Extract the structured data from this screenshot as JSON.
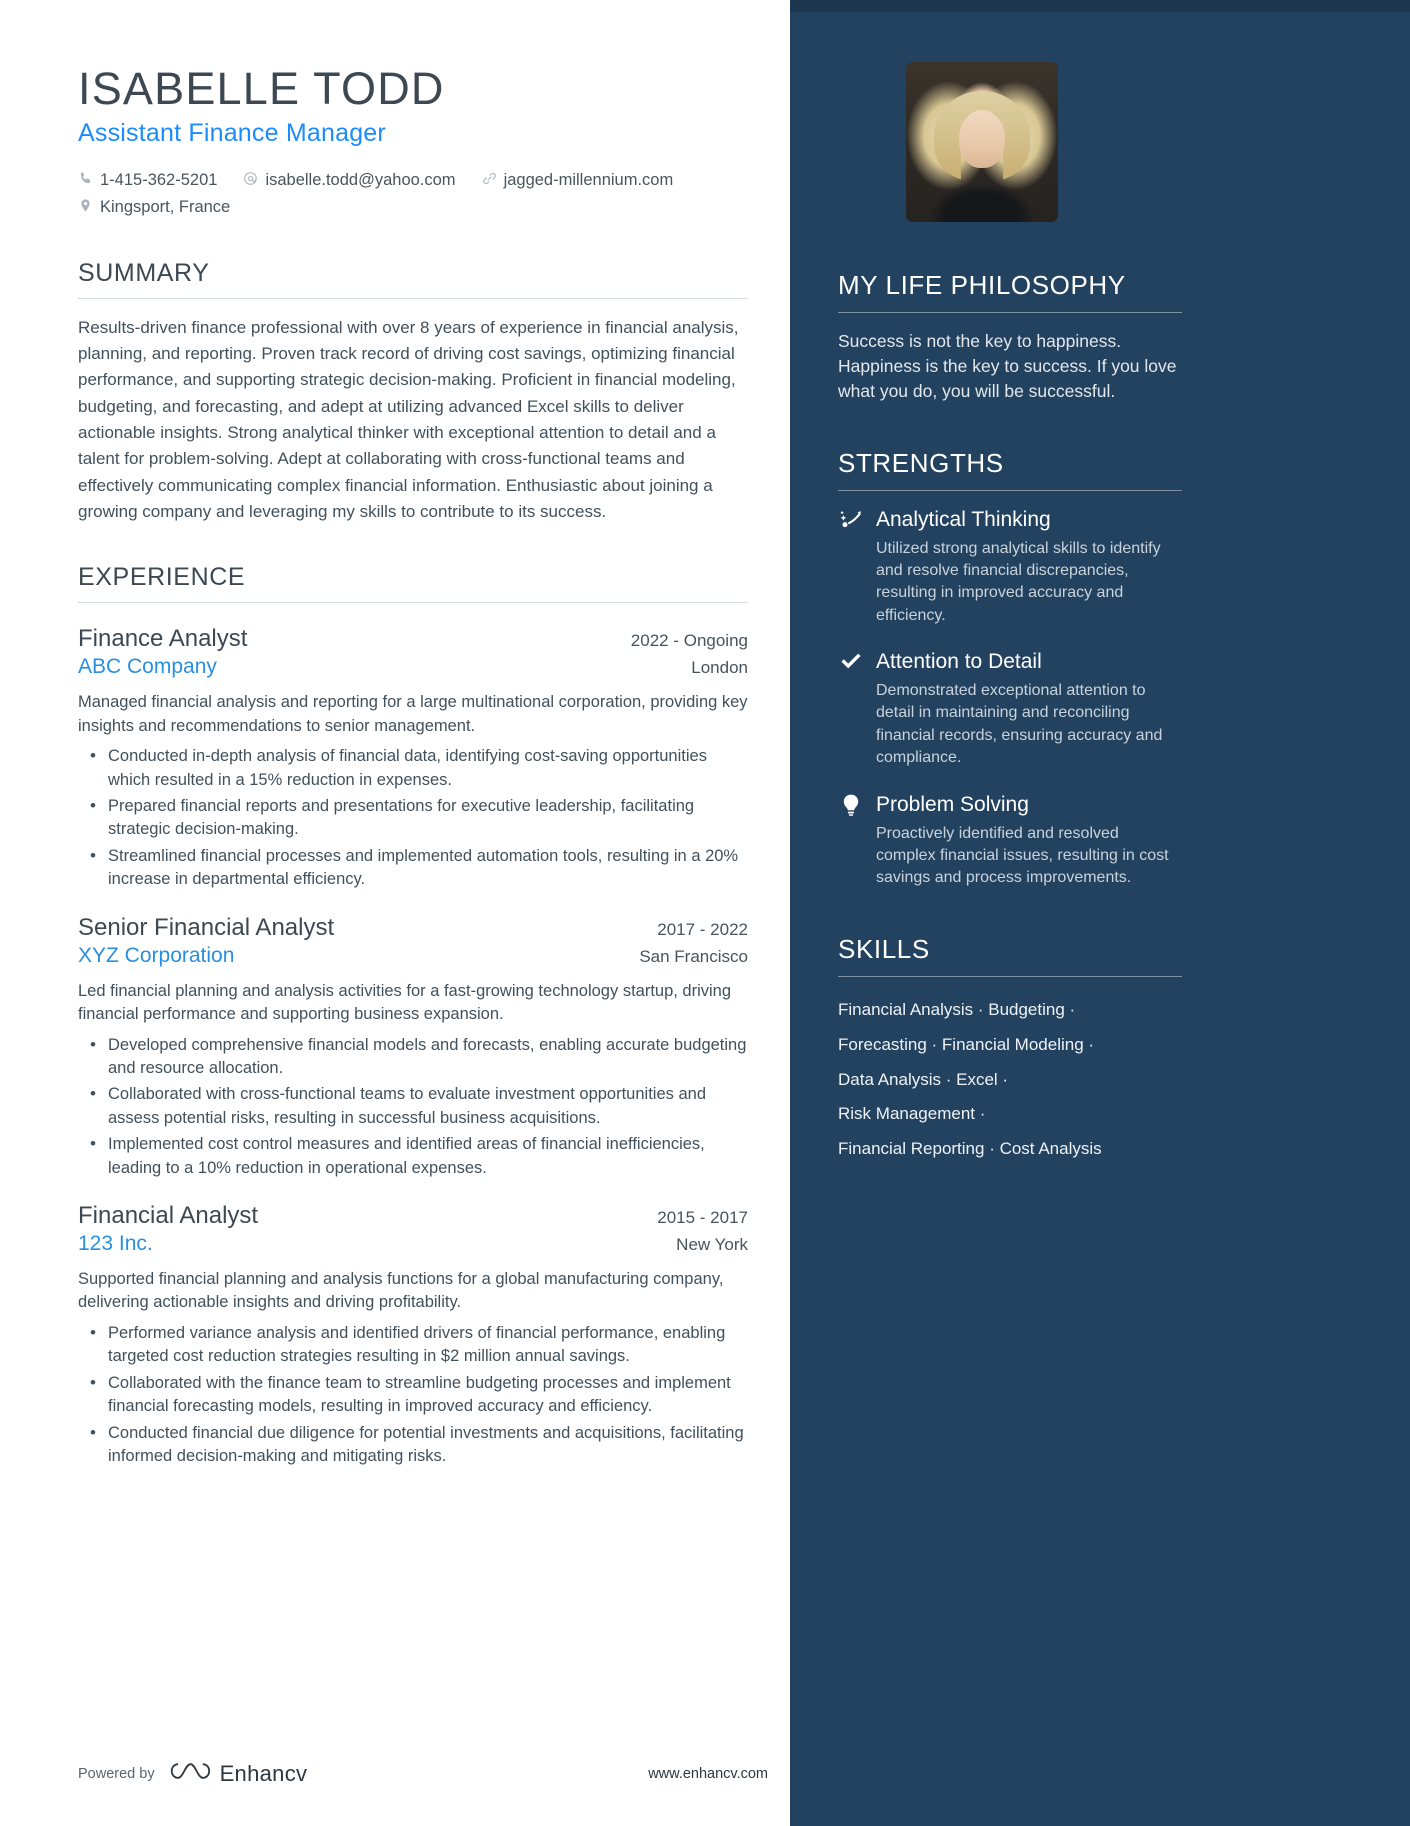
{
  "colors": {
    "sidebar_bg": "#23425f",
    "accent_blue": "#1a8cff",
    "company_blue": "#2a8fe0",
    "heading_gray": "#3d4852"
  },
  "header": {
    "name": "ISABELLE TODD",
    "role": "Assistant Finance Manager",
    "contacts": [
      {
        "icon": "phone-icon",
        "text": "1-415-362-5201"
      },
      {
        "icon": "email-icon",
        "text": "isabelle.todd@yahoo.com"
      },
      {
        "icon": "link-icon",
        "text": "jagged-millennium.com"
      }
    ],
    "location": {
      "icon": "location-pin-icon",
      "text": "Kingsport, France"
    }
  },
  "summary": {
    "title": "SUMMARY",
    "text": "Results-driven finance professional with over 8 years of experience in financial analysis, planning, and reporting. Proven track record of driving cost savings, optimizing financial performance, and supporting strategic decision-making. Proficient in financial modeling, budgeting, and forecasting, and adept at utilizing advanced Excel skills to deliver actionable insights. Strong analytical thinker with exceptional attention to detail and a talent for problem-solving. Adept at collaborating with cross-functional teams and effectively communicating complex financial information. Enthusiastic about joining a growing company and leveraging my skills to contribute to its success."
  },
  "experience": {
    "title": "EXPERIENCE",
    "jobs": [
      {
        "title": "Finance Analyst",
        "dates": "2022 - Ongoing",
        "company": "ABC Company",
        "location": "London",
        "description": "Managed financial analysis and reporting for a large multinational corporation, providing key insights and recommendations to senior management.",
        "bullets": [
          "Conducted in-depth analysis of financial data, identifying cost-saving opportunities which resulted in a 15% reduction in expenses.",
          "Prepared financial reports and presentations for executive leadership, facilitating strategic decision-making.",
          "Streamlined financial processes and implemented automation tools, resulting in a 20% increase in departmental efficiency."
        ]
      },
      {
        "title": "Senior Financial Analyst",
        "dates": "2017 - 2022",
        "company": "XYZ Corporation",
        "location": "San Francisco",
        "description": "Led financial planning and analysis activities for a fast-growing technology startup, driving financial performance and supporting business expansion.",
        "bullets": [
          "Developed comprehensive financial models and forecasts, enabling accurate budgeting and resource allocation.",
          "Collaborated with cross-functional teams to evaluate investment opportunities and assess potential risks, resulting in successful business acquisitions.",
          "Implemented cost control measures and identified areas of financial inefficiencies, leading to a 10% reduction in operational expenses."
        ]
      },
      {
        "title": "Financial Analyst",
        "dates": "2015 - 2017",
        "company": "123 Inc.",
        "location": "New York",
        "description": "Supported financial planning and analysis functions for a global manufacturing company, delivering actionable insights and driving profitability.",
        "bullets": [
          "Performed variance analysis and identified drivers of financial performance, enabling targeted cost reduction strategies resulting in $2 million annual savings.",
          "Collaborated with the finance team to streamline budgeting processes and implement financial forecasting models, resulting in improved accuracy and efficiency.",
          "Conducted financial due diligence for potential investments and acquisitions, facilitating informed decision-making and mitigating risks."
        ]
      }
    ]
  },
  "philosophy": {
    "title": "MY LIFE PHILOSOPHY",
    "text": "Success is not the key to happiness. Happiness is the key to success. If you love what you do, you will be successful."
  },
  "strengths": {
    "title": "STRENGTHS",
    "items": [
      {
        "icon": "analytics-arrow-icon",
        "title": "Analytical Thinking",
        "description": "Utilized strong analytical skills to identify and resolve financial discrepancies, resulting in improved accuracy and efficiency."
      },
      {
        "icon": "checkmark-icon",
        "title": "Attention to Detail",
        "description": "Demonstrated exceptional attention to detail in maintaining and reconciling financial records, ensuring accuracy and compliance."
      },
      {
        "icon": "lightbulb-icon",
        "title": "Problem Solving",
        "description": "Proactively identified and resolved complex financial issues, resulting in cost savings and process improvements."
      }
    ]
  },
  "skills": {
    "title": "SKILLS",
    "lines": [
      "Financial Analysis · Budgeting ·",
      "Forecasting · Financial Modeling ·",
      "Data Analysis · Excel ·",
      "Risk Management ·",
      "Financial Reporting · Cost Analysis"
    ]
  },
  "footer": {
    "powered_by": "Powered by",
    "brand": "Enhancv",
    "url": "www.enhancv.com"
  }
}
